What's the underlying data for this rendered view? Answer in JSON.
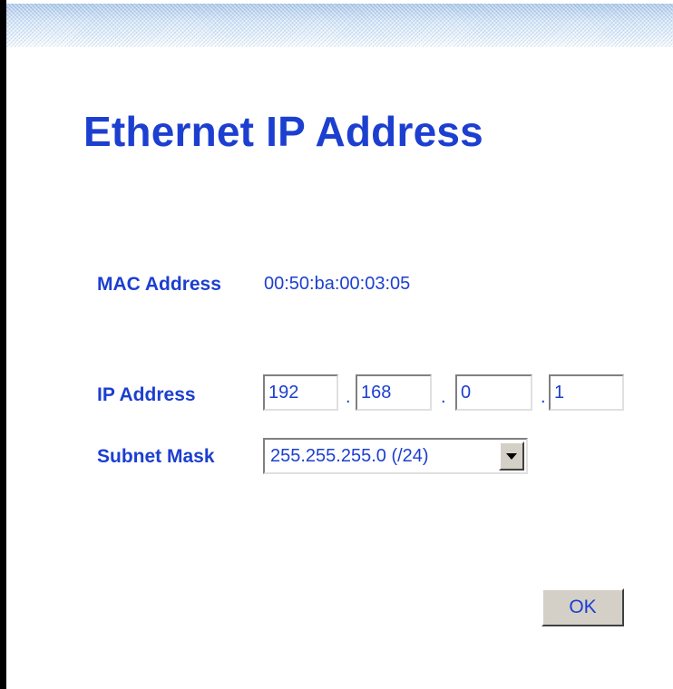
{
  "page": {
    "title": "Ethernet IP Address"
  },
  "mac_address": {
    "label": "MAC Address",
    "value": "00:50:ba:00:03:05"
  },
  "ip_address": {
    "label": "IP Address",
    "octets": [
      "192",
      "168",
      "0",
      "1"
    ],
    "separator": "."
  },
  "subnet_mask": {
    "label": "Subnet Mask",
    "selected": "255.255.255.0 (/24)"
  },
  "ok_button": {
    "label": "OK"
  },
  "colors": {
    "text_blue": "#1c3fd0",
    "button_face": "#d4d0c8",
    "banner": "#c8dcf0"
  }
}
